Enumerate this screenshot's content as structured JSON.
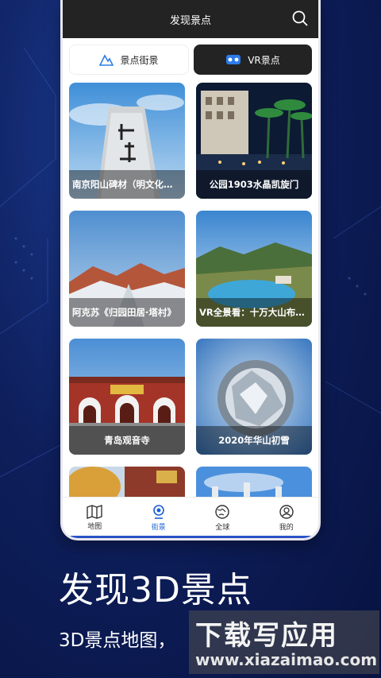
{
  "header": {
    "title": "发现景点"
  },
  "tabs": [
    {
      "label": "景点街景",
      "active": false
    },
    {
      "label": "VR景点",
      "active": true
    }
  ],
  "cards": [
    {
      "caption": "南京阳山碑材（明文化…"
    },
    {
      "caption": "公园1903水晶凯旋门"
    },
    {
      "caption": "阿克苏《归园田居·塔村》"
    },
    {
      "caption": "VR全景看：十万大山布…"
    },
    {
      "caption": "青岛观音寺"
    },
    {
      "caption": "2020年华山初雪"
    }
  ],
  "nav": [
    {
      "label": "地图",
      "icon": "map-icon"
    },
    {
      "label": "街景",
      "icon": "streetview-icon",
      "active": true
    },
    {
      "label": "全球",
      "icon": "globe-icon"
    },
    {
      "label": "我的",
      "icon": "user-icon"
    }
  ],
  "promo": {
    "headline": "发现3D景点",
    "subline": "3D景点地图，"
  },
  "watermark": {
    "title": "下载写应用",
    "url": "www.xiazaimao.com"
  },
  "colors": {
    "accent": "#1a5fd6",
    "topbar": "#232323",
    "background": "#0e1f5c"
  }
}
